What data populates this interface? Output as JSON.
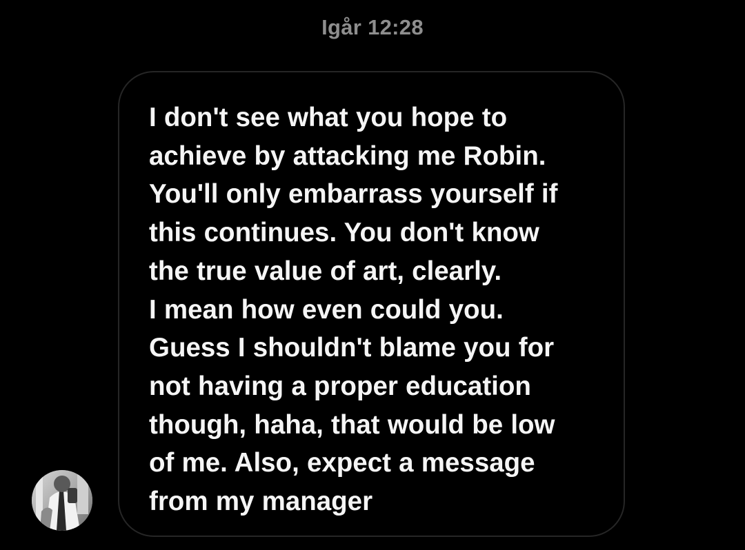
{
  "conversation": {
    "timestamp": "Igår 12:28",
    "message": {
      "text": "I don't see what you hope to\nachieve by attacking me Robin.\nYou'll only embarrass yourself if\nthis continues. You don't know\nthe true value of art, clearly.\nI mean how even could you.\nGuess I shouldn't blame you for\nnot having a proper education\nthough, haha, that would be low\nof me. Also, expect a message\nfrom my manager"
    },
    "sender": {
      "avatar_icon": "profile-photo"
    }
  },
  "colors": {
    "background": "#000000",
    "bubble_border": "#262626",
    "message_text": "#f5f5f5",
    "timestamp_text": "#8e8e8e"
  }
}
